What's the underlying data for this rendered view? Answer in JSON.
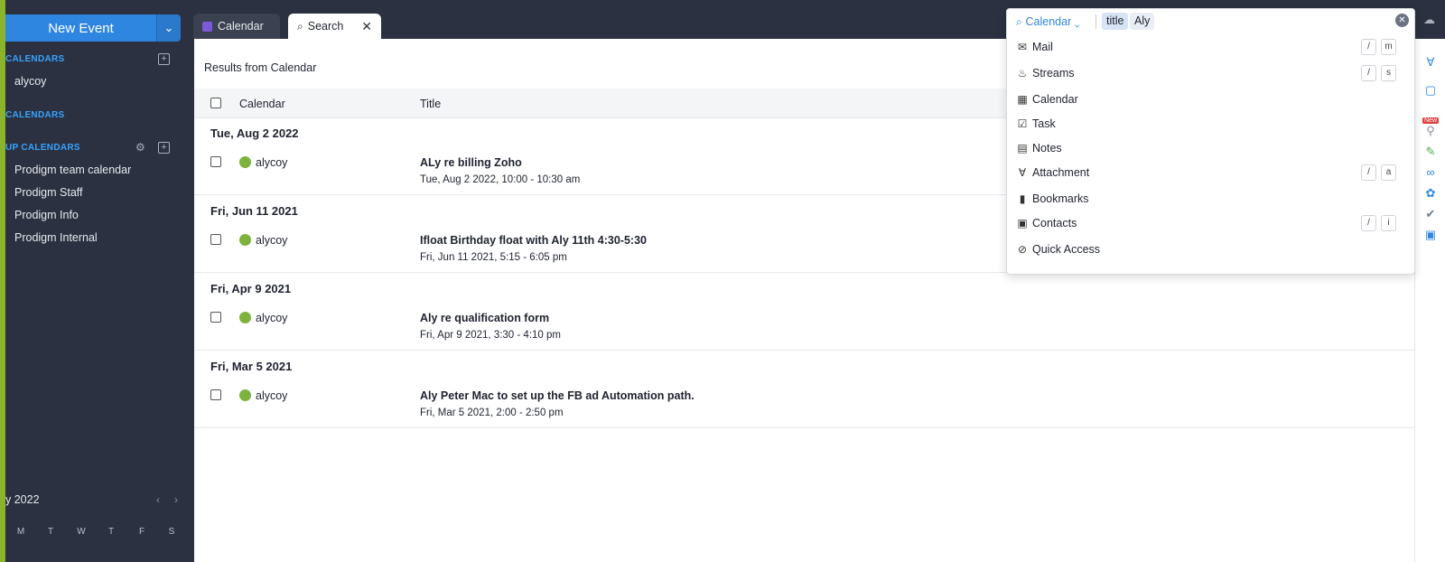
{
  "sidebar": {
    "new_event_label": "New Event",
    "sections": {
      "my_calendars": "CALENDARS",
      "shared_calendars": "CALENDARS",
      "group_calendars": "UP CALENDARS"
    },
    "my_items": [
      "alycoy"
    ],
    "group_items": [
      "Prodigm team calendar",
      "Prodigm Staff",
      "Prodigm Info",
      "Prodigm Internal"
    ],
    "mini_calendar": {
      "month_label": "y 2022",
      "weekdays": [
        "M",
        "T",
        "W",
        "T",
        "F",
        "S"
      ]
    }
  },
  "tabs": [
    {
      "label": "Calendar",
      "active": false
    },
    {
      "label": "Search",
      "active": true
    }
  ],
  "results": {
    "title": "Results from Calendar",
    "columns": {
      "calendar": "Calendar",
      "title": "Title"
    },
    "groups": [
      {
        "date": "Tue, Aug 2 2022",
        "calendar": "alycoy",
        "title": "ALy re billing Zoho",
        "time": "Tue, Aug 2 2022, 10:00 - 10:30 am"
      },
      {
        "date": "Fri, Jun 11 2021",
        "calendar": "alycoy",
        "title": "Ifloat Birthday float with Aly 11th 4:30-5:30",
        "time": "Fri, Jun 11 2021, 5:15 - 6:05 pm"
      },
      {
        "date": "Fri, Apr 9 2021",
        "calendar": "alycoy",
        "title": "Aly re qualification form",
        "time": "Fri, Apr 9 2021, 3:30 - 4:10 pm"
      },
      {
        "date": "Fri, Mar 5 2021",
        "calendar": "alycoy",
        "title": "Aly Peter Mac to set up the FB ad Automation path.",
        "time": "Fri, Mar 5 2021, 2:00 - 2:50 pm"
      }
    ]
  },
  "search": {
    "scope": "Calendar",
    "chip_key": "title",
    "chip_value": "Aly",
    "clear_icon": "close-circle-icon",
    "menu": [
      {
        "label": "Mail",
        "icon": "mail-icon",
        "shortcut": [
          "/",
          "m"
        ]
      },
      {
        "label": "Streams",
        "icon": "streams-icon",
        "shortcut": [
          "/",
          "s"
        ]
      },
      {
        "label": "Calendar",
        "icon": "calendar-icon",
        "shortcut": []
      },
      {
        "label": "Task",
        "icon": "task-icon",
        "shortcut": []
      },
      {
        "label": "Notes",
        "icon": "notes-icon",
        "shortcut": []
      },
      {
        "label": "Attachment",
        "icon": "attachment-icon",
        "shortcut": [
          "/",
          "a"
        ]
      },
      {
        "label": "Bookmarks",
        "icon": "bookmark-icon",
        "shortcut": []
      },
      {
        "label": "Contacts",
        "icon": "contacts-icon",
        "shortcut": [
          "/",
          "i"
        ]
      },
      {
        "label": "Quick Access",
        "icon": "quick-access-icon",
        "shortcut": []
      }
    ]
  },
  "rail": {
    "new_badge": "New"
  },
  "colors": {
    "accent": "#2f86e0",
    "sidebar_bg": "#2b3140",
    "calendar_dot": "#7eb23f",
    "green_strip": "#8ab52b"
  }
}
